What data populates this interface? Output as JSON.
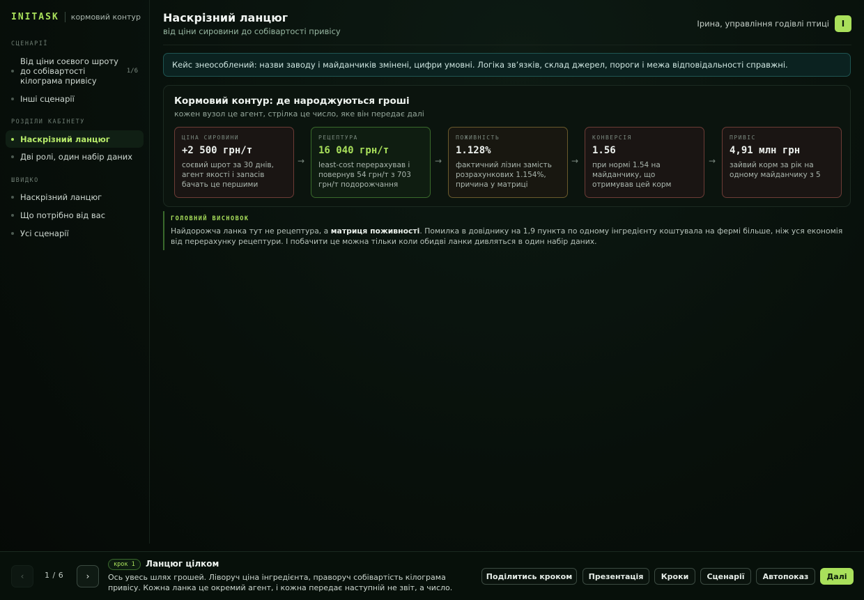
{
  "brand": {
    "logo": "INITASK",
    "subtitle": "кормовий контур"
  },
  "sidebar": {
    "sections": [
      {
        "title": "СЦЕНАРІЇ",
        "items": [
          {
            "label": "Від ціни соєвого шроту до собівартості кілограма привісу",
            "count": "1/6",
            "active": false
          },
          {
            "label": "Інші сценарії",
            "active": false
          }
        ]
      },
      {
        "title": "РОЗДІЛИ КАБІНЕТУ",
        "items": [
          {
            "label": "Наскрізний ланцюг",
            "active": true
          },
          {
            "label": "Дві ролі, один набір даних",
            "active": false
          }
        ]
      },
      {
        "title": "ШВИДКО",
        "items": [
          {
            "label": "Наскрізний ланцюг",
            "active": false
          },
          {
            "label": "Що потрібно від вас",
            "active": false
          },
          {
            "label": "Усі сценарії",
            "active": false
          }
        ]
      }
    ]
  },
  "header": {
    "title": "Наскрізний ланцюг",
    "subtitle": "від ціни сировини до собівартості привісу",
    "user_name": "Ірина, управління годівлі птиці",
    "avatar_letter": "І"
  },
  "notice": "Кейс знеособлений: назви заводу і майданчиків змінені, цифри умовні. Логіка зв’язків, склад джерел, пороги і межа відповідальності справжні.",
  "panel": {
    "title": "Кормовий контур: де народжуються гроші",
    "subtitle": "кожен вузол це агент, стрілка це число, яке він передає далі",
    "nodes": [
      {
        "label": "ЦІНА СИРОВИНИ",
        "value": "+2 500 грн/т",
        "desc": "соєвий шрот за 30 днів, агент якості і запасів бачать це першими",
        "tone": "red"
      },
      {
        "label": "РЕЦЕПТУРА",
        "value": "16 040 грн/т",
        "desc": "least-cost перерахував і повернув 54 грн/т з 703 грн/т подорожчання",
        "tone": "green"
      },
      {
        "label": "ПОЖИВНІСТЬ",
        "value": "1.128%",
        "desc": "фактичний лізин замість розрахункових 1.154%, причина у матриці",
        "tone": "amber"
      },
      {
        "label": "КОНВЕРСІЯ",
        "value": "1.56",
        "desc": "при нормі 1.54 на майданчику, що отримував цей корм",
        "tone": "red"
      },
      {
        "label": "ПРИВІС",
        "value": "4,91 млн грн",
        "desc": "зайвий корм за рік на одному майданчику з 5",
        "tone": "red"
      }
    ],
    "arrow": "→"
  },
  "conclusion": {
    "label": "ГОЛОВНИЙ ВИСНОВОК",
    "text_before": "Найдорожча ланка тут не рецептура, а ",
    "text_bold": "матриця поживності",
    "text_after": ". Помилка в довіднику на 1,9 пункта по одному інгредієнту коштувала на фермі більше, ніж уся економія від перерахунку рецептури. І побачити це можна тільки коли обидві ланки дивляться в один набір даних."
  },
  "footer": {
    "prev_icon": "‹",
    "next_icon": "›",
    "page": "1 / 6",
    "step_badge": "крок 1",
    "step_title": "Ланцюг цілком",
    "step_desc": "Ось увесь шлях грошей. Ліворуч ціна інгредієнта, праворуч собівартість кілограма привісу. Кожна ланка це окремий агент, і кожна передає наступній не звіт, а число.",
    "actions": [
      "Поділитись кроком",
      "Презентація",
      "Кроки",
      "Сценарії",
      "Автопоказ",
      "Далі"
    ]
  },
  "colors": {
    "accent": "#a9e05b",
    "notice_border": "#1f5552",
    "red_border": "#6d3c36",
    "green_border": "#3a6a2c",
    "amber_border": "#6a5a2c"
  }
}
